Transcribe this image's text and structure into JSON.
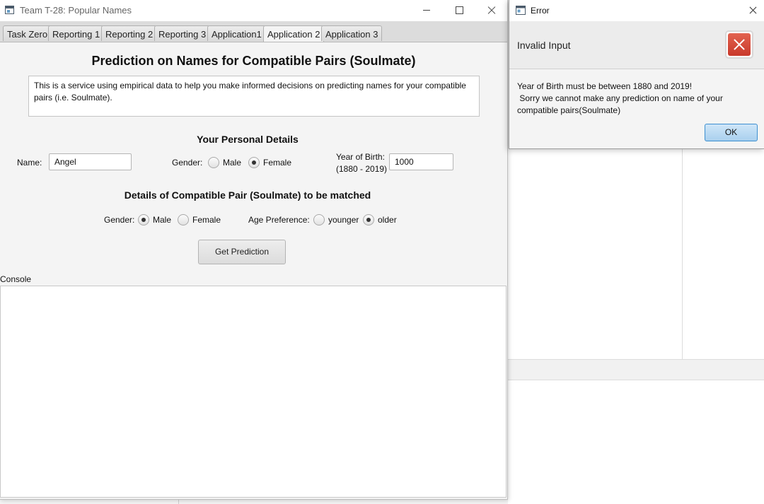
{
  "main_window": {
    "title": "Team T-28: Popular Names",
    "tabs": [
      {
        "label": "Task Zero",
        "active": false
      },
      {
        "label": "Reporting 1",
        "active": false
      },
      {
        "label": "Reporting 2",
        "active": false
      },
      {
        "label": "Reporting 3",
        "active": false
      },
      {
        "label": "Application1",
        "active": false
      },
      {
        "label": "Application 2",
        "active": true
      },
      {
        "label": "Application 3",
        "active": false
      }
    ]
  },
  "page": {
    "title": "Prediction on Names for Compatible Pairs (Soulmate)",
    "description": "This is a service using empirical data to help you make informed decisions on predicting names for your compatible pairs (i.e. Soulmate)."
  },
  "personal": {
    "heading": "Your Personal Details",
    "name_label": "Name:",
    "name_value": "Angel",
    "gender_label": "Gender:",
    "gender_options": [
      "Male",
      "Female"
    ],
    "gender_selected": "Female",
    "yob_label_line1": "Year of Birth:",
    "yob_label_line2": "(1880 - 2019)",
    "yob_value": "1000"
  },
  "soulmate": {
    "heading": "Details of Compatible Pair (Soulmate) to be matched",
    "gender_label": "Gender:",
    "gender_options": [
      "Male",
      "Female"
    ],
    "gender_selected": "Male",
    "age_label": "Age Preference:",
    "age_options": [
      "younger",
      "older"
    ],
    "age_selected": "older"
  },
  "actions": {
    "predict_label": "Get Prediction"
  },
  "console": {
    "label": "Console"
  },
  "dialog": {
    "title": "Error",
    "header": "Invalid Input",
    "message_lines": [
      "Year of Birth must be between 1880 and 2019!",
      " Sorry we cannot make any prediction on name of your",
      "compatible pairs(Soulmate)"
    ],
    "ok_label": "OK",
    "icon": "error-icon",
    "accent_color": "#c9392b"
  }
}
